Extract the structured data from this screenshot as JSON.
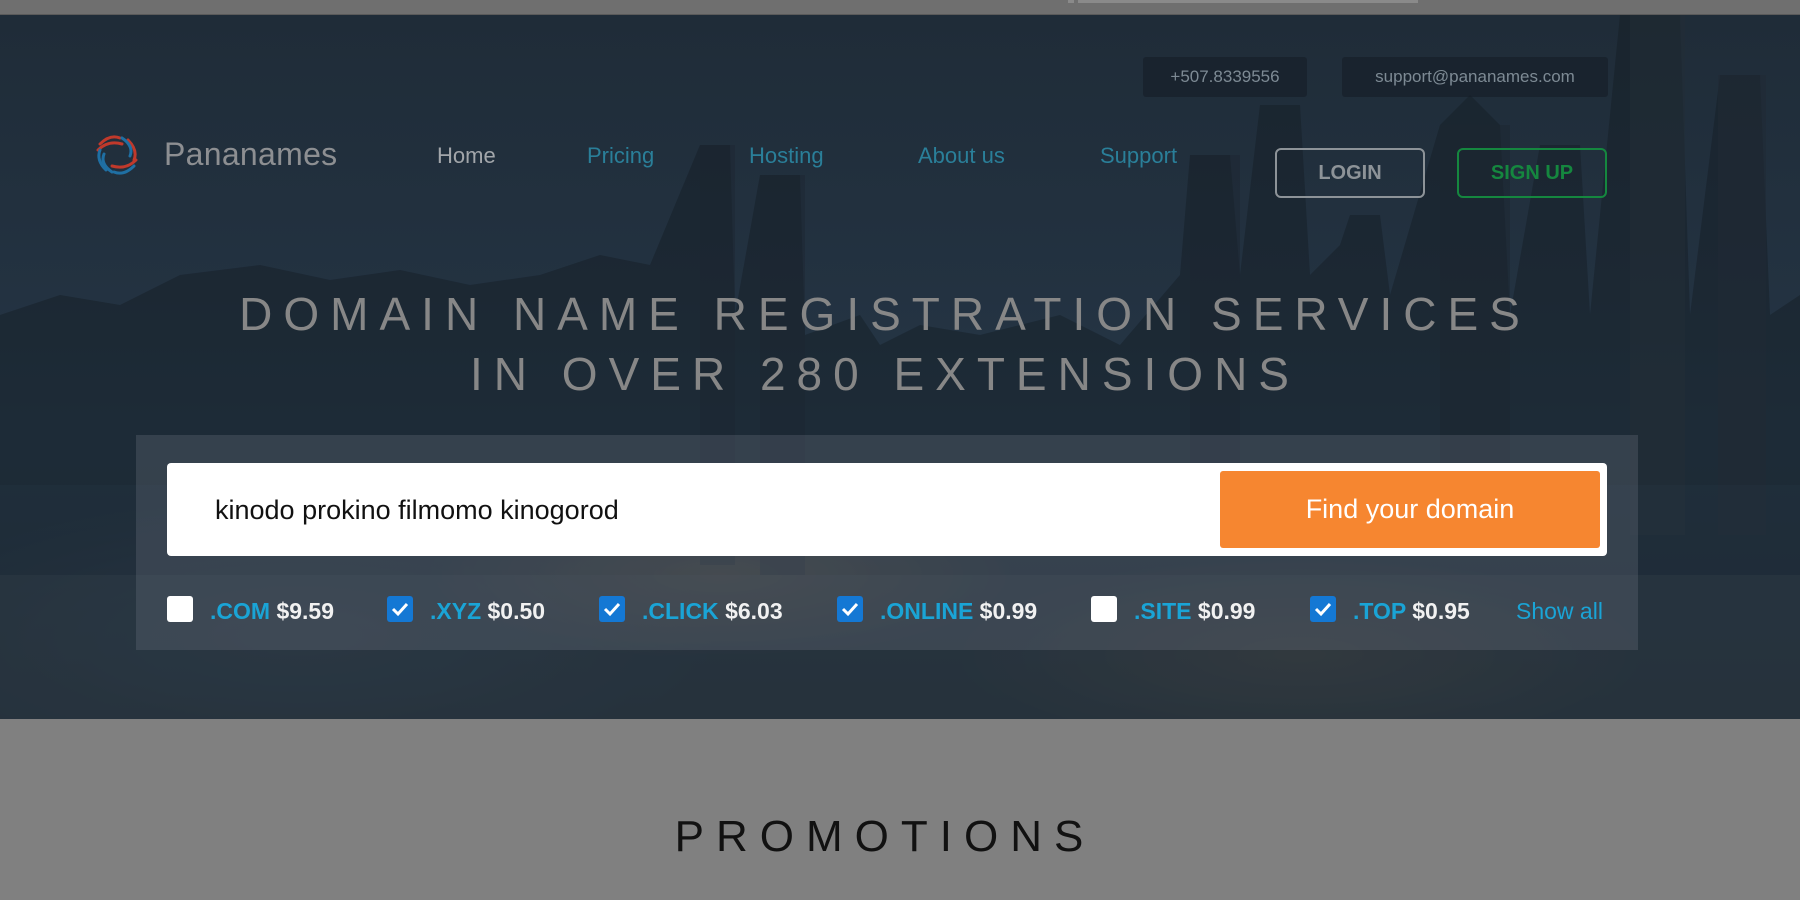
{
  "header": {
    "phone": "+507.8339556",
    "email": "support@pananames.com",
    "logo_text": "Pananames",
    "nav": {
      "home": "Home",
      "pricing": "Pricing",
      "hosting": "Hosting",
      "about": "About us",
      "support": "Support"
    },
    "login_label": "LOGIN",
    "signup_label": "SIGN UP"
  },
  "hero": {
    "headline_line1": "DOMAIN NAME REGISTRATION SERVICES",
    "headline_line2": "IN OVER 280 EXTENSIONS"
  },
  "search": {
    "value": "kinodo prokino filmomo kinogorod",
    "button_label": "Find your domain",
    "extensions": [
      {
        "name": ".COM",
        "price": "$9.59",
        "checked": false
      },
      {
        "name": ".XYZ",
        "price": "$0.50",
        "checked": true
      },
      {
        "name": ".CLICK",
        "price": "$6.03",
        "checked": true
      },
      {
        "name": ".ONLINE",
        "price": "$0.99",
        "checked": true
      },
      {
        "name": ".SITE",
        "price": "$0.99",
        "checked": false
      },
      {
        "name": ".TOP",
        "price": "$0.95",
        "checked": true
      }
    ],
    "show_all_label": "Show all"
  },
  "promotions": {
    "title": "PROMOTIONS"
  },
  "colors": {
    "accent_orange": "#f68630",
    "signup_green": "#15873f",
    "extension_blue": "#1aa4d6",
    "checkbox_blue": "#1478d4"
  }
}
